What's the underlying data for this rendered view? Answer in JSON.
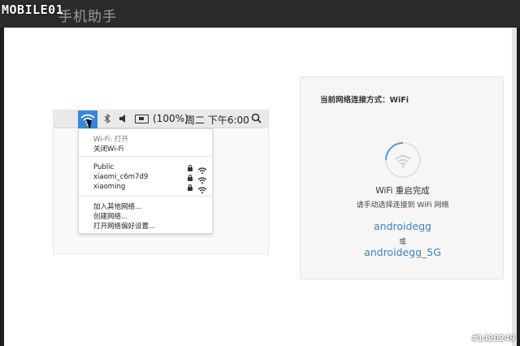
{
  "header": {
    "title": "手机助手",
    "watermark": "MOBILE01"
  },
  "menubar": {
    "battery_text": "(100%)",
    "datetime": "周二 下午6:00",
    "icons": [
      "wifi-icon",
      "bluetooth-icon",
      "volume-icon",
      "battery-icon",
      "search-icon"
    ]
  },
  "wifi_menu": {
    "status": "Wi-Fi: 打开",
    "toggle": "关闭Wi-Fi",
    "networks": [
      {
        "name": "Public",
        "locked": true
      },
      {
        "name": "xiaomi_c6m7d9",
        "locked": true
      },
      {
        "name": "xiaoming",
        "locked": true
      }
    ],
    "actions": [
      "加入其他网络...",
      "创建网络...",
      "打开网络偏好设置..."
    ]
  },
  "card": {
    "connection_label": "当前网络连接方式：",
    "connection_value": "WiFi",
    "status": "WiFi 重启完成",
    "hint": "请手动选择连接到 WiFi 网络",
    "ssid_1": "androidegg",
    "or": "或",
    "ssid_2": "androidegg_5G"
  },
  "footer": {
    "image_id": "#1420249"
  },
  "colors": {
    "accent": "#3a85d8",
    "link": "#3d83b9",
    "topbar": "#2b2b2b"
  }
}
